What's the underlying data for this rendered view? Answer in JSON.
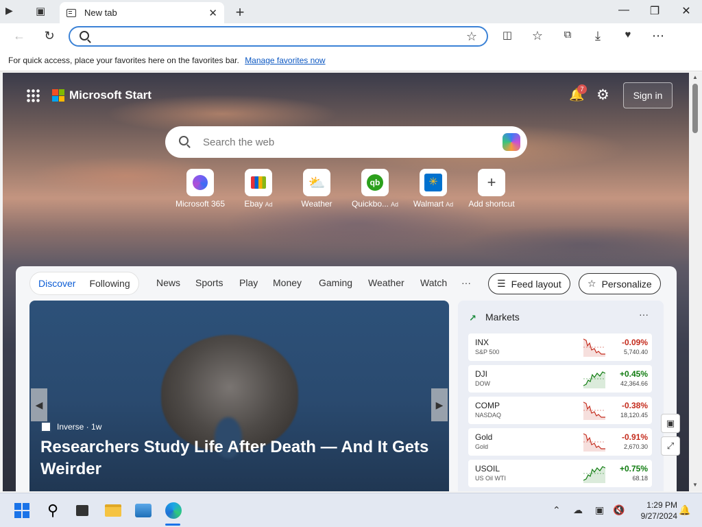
{
  "browser": {
    "tab_title": "New tab",
    "tab_close": "✕",
    "new_tab": "+",
    "window_controls": [
      "—",
      "❐",
      "✕"
    ]
  },
  "favbar": {
    "text": "For quick access, place your favorites here on the favorites bar.",
    "link": "Manage favorites now"
  },
  "header": {
    "brand": "Microsoft Start",
    "notification_count": "7",
    "signin": "Sign in"
  },
  "search": {
    "placeholder": "Search the web"
  },
  "shortcuts": [
    {
      "label": "Microsoft 365",
      "ad": "",
      "icon": "microsoft-365-icon"
    },
    {
      "label": "Ebay",
      "ad": "Ad",
      "icon": "ebay-icon"
    },
    {
      "label": "Weather",
      "ad": "",
      "icon": "weather-icon"
    },
    {
      "label": "Quickbo...",
      "ad": "Ad",
      "icon": "quickbooks-icon"
    },
    {
      "label": "Walmart",
      "ad": "Ad",
      "icon": "walmart-icon"
    },
    {
      "label": "Add shortcut",
      "ad": "",
      "icon": "plus-icon"
    }
  ],
  "feed": {
    "discover": "Discover",
    "following": "Following",
    "nav": [
      "News",
      "Sports",
      "Play",
      "Money",
      "Gaming",
      "Weather",
      "Watch",
      "···"
    ],
    "feed_layout": "Feed layout",
    "personalize": "Personalize"
  },
  "story": {
    "source": "Inverse · 1w",
    "headline": "Researchers Study Life After Death — And It Gets Weirder"
  },
  "markets": {
    "title": "Markets",
    "more": "···",
    "rows": [
      {
        "symbol": "INX",
        "name": "S&P 500",
        "change": "-0.09%",
        "price": "5,740.40",
        "dir": "down"
      },
      {
        "symbol": "DJI",
        "name": "DOW",
        "change": "+0.45%",
        "price": "42,364.66",
        "dir": "up"
      },
      {
        "symbol": "COMP",
        "name": "NASDAQ",
        "change": "-0.38%",
        "price": "18,120.45",
        "dir": "down"
      },
      {
        "symbol": "Gold",
        "name": "Gold",
        "change": "-0.91%",
        "price": "2,670.30",
        "dir": "down"
      },
      {
        "symbol": "USOIL",
        "name": "US Oil WTI",
        "change": "+0.75%",
        "price": "68.18",
        "dir": "up"
      }
    ]
  },
  "taskbar": {
    "time": "1:29 PM",
    "date": "9/27/2024"
  },
  "colors": {
    "accent": "#0b5cd5",
    "down": "#c42b1c",
    "up": "#107c10"
  }
}
